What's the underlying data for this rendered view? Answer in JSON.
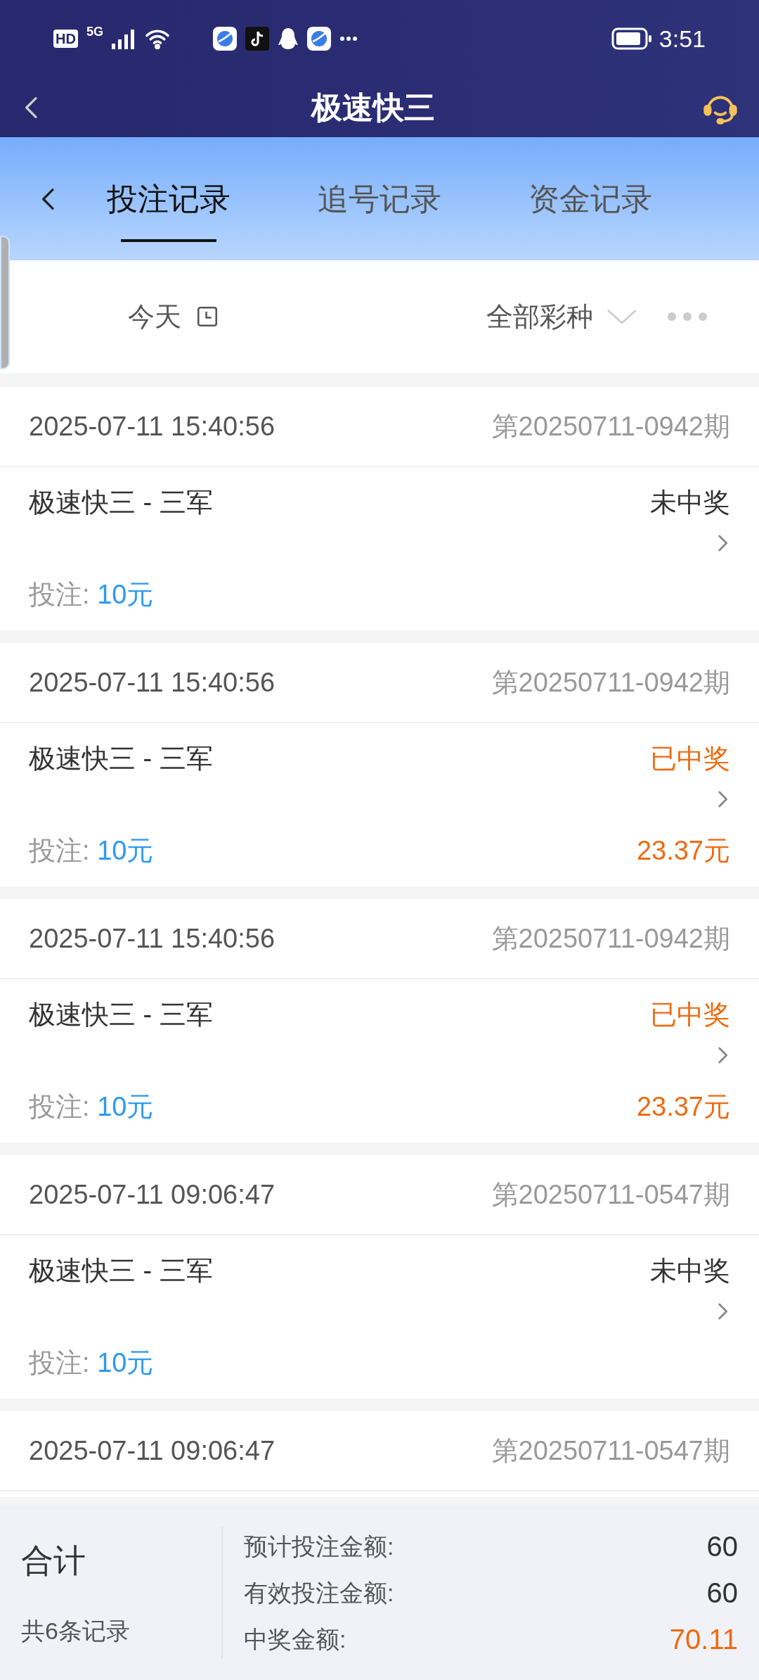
{
  "status_bar": {
    "hd": "HD",
    "network": "5G",
    "time": "3:51"
  },
  "header": {
    "title": "极速快三"
  },
  "tabs": [
    {
      "label": "投注记录",
      "selected": true
    },
    {
      "label": "追号记录",
      "selected": false
    },
    {
      "label": "资金记录",
      "selected": false
    }
  ],
  "filters": {
    "date": "今天",
    "lottery": "全部彩种"
  },
  "records": [
    {
      "time": "2025-07-11 15:40:56",
      "issue": "第20250711-0942期",
      "game": "极速快三 - 三军",
      "status": "未中奖",
      "won": false,
      "bet_label": "投注:",
      "bet": "10元"
    },
    {
      "time": "2025-07-11 15:40:56",
      "issue": "第20250711-0942期",
      "game": "极速快三 - 三军",
      "status": "已中奖",
      "won": true,
      "bet_label": "投注:",
      "bet": "10元",
      "prize": "23.37元"
    },
    {
      "time": "2025-07-11 15:40:56",
      "issue": "第20250711-0942期",
      "game": "极速快三 - 三军",
      "status": "已中奖",
      "won": true,
      "bet_label": "投注:",
      "bet": "10元",
      "prize": "23.37元"
    },
    {
      "time": "2025-07-11 09:06:47",
      "issue": "第20250711-0547期",
      "game": "极速快三 - 三军",
      "status": "未中奖",
      "won": false,
      "bet_label": "投注:",
      "bet": "10元"
    },
    {
      "time": "2025-07-11 09:06:47",
      "issue": "第20250711-0547期"
    }
  ],
  "summary": {
    "title": "合计",
    "count": "共6条记录",
    "rows": [
      {
        "label": "预计投注金额:",
        "value": "60",
        "kind": "plain"
      },
      {
        "label": "有效投注金额:",
        "value": "60",
        "kind": "plain"
      },
      {
        "label": "中奖金额:",
        "value": "70.11",
        "kind": "prize"
      }
    ]
  }
}
